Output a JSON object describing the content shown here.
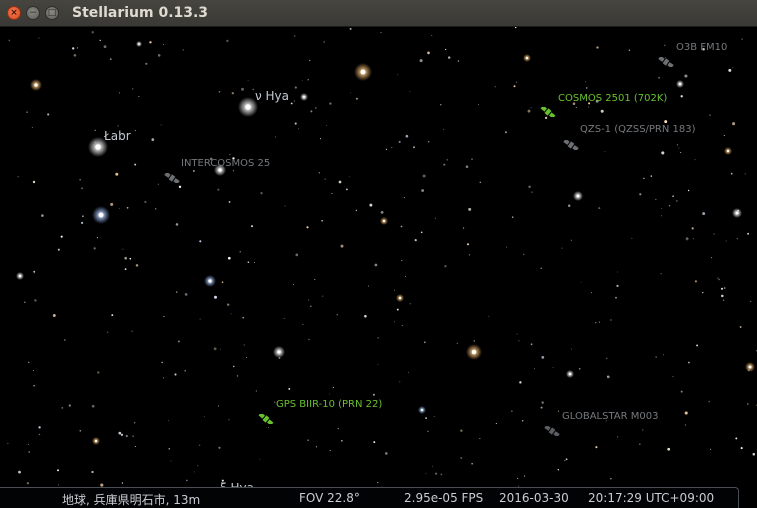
{
  "window": {
    "title": "Stellarium 0.13.3",
    "close_glyph": "×",
    "minimize_glyph": "−",
    "maximize_glyph": "□"
  },
  "sky": {
    "star_labels": [
      {
        "id": "nu-hya",
        "text": "ν Hya"
      },
      {
        "id": "labr",
        "text": "Łabr"
      },
      {
        "id": "xi-hya",
        "text": "ξ Hya"
      }
    ],
    "satellite_labels": [
      {
        "id": "o3b",
        "text": "O3B FM10",
        "color": "#75797d"
      },
      {
        "id": "cosmos",
        "text": "COSMOS 2501 (702K)",
        "color": "#69c02e"
      },
      {
        "id": "qzs",
        "text": "QZS-1 (QZSS/PRN 183)",
        "color": "#75797d"
      },
      {
        "id": "intercosmos",
        "text": "INTERCOSMOS 25",
        "color": "#75797d"
      },
      {
        "id": "gps",
        "text": "GPS BIIR-10 (PRN 22)",
        "color": "#69c02e"
      },
      {
        "id": "globalstar",
        "text": "GLOBALSTAR M003",
        "color": "#75797d"
      }
    ]
  },
  "status": {
    "location": "地球, 兵庫県明石市, 13m",
    "fov": "FOV 22.8°",
    "fps": "2.95e-05 FPS",
    "date": "2016-03-30",
    "time": "20:17:29 UTC+09:00"
  }
}
